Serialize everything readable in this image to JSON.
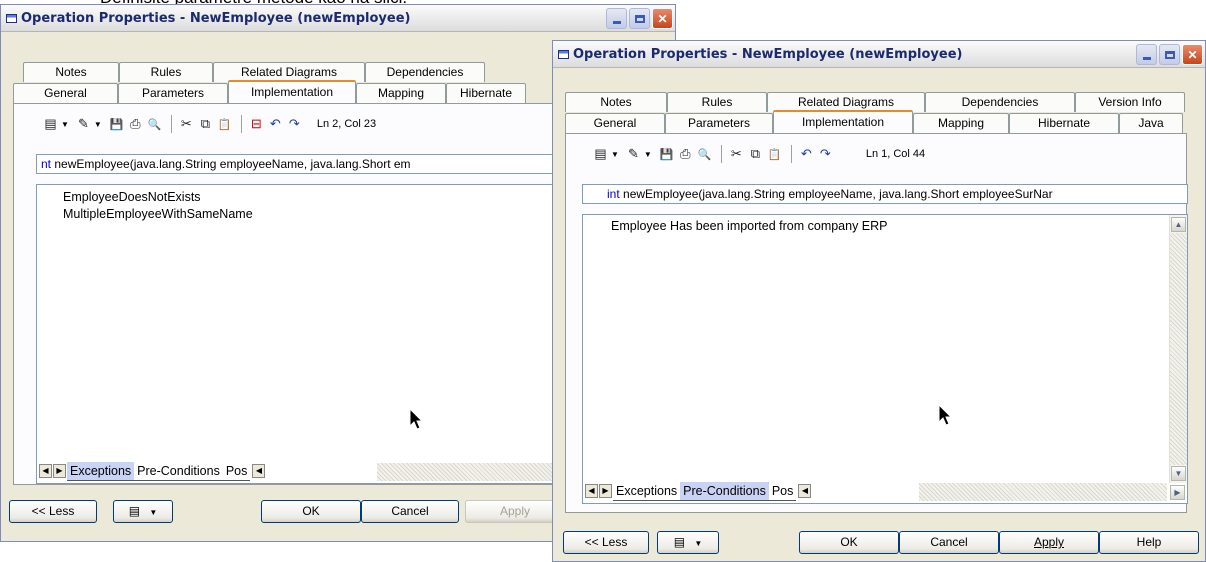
{
  "caption": "Definišite parametre metode kao na slici.",
  "window_left": {
    "title": "Operation Properties - NewEmployee (newEmployee)",
    "tabs_row1": [
      "Notes",
      "Rules",
      "Related Diagrams",
      "Dependencies"
    ],
    "tabs_row2": [
      "General",
      "Parameters",
      "Implementation",
      "Mapping",
      "Hibernate"
    ],
    "active_tab": "Implementation",
    "cursor_pos": "Ln 2, Col 23",
    "signature_kw": "nt",
    "signature_rest": " newEmployee(java.lang.String employeeName, java.lang.Short em",
    "lines": [
      "EmployeeDoesNotExists",
      "MultipleEmployeeWithSameName"
    ],
    "subtabs": [
      "Exceptions",
      "Pre-Conditions",
      "Pos"
    ],
    "selected_subtab": "Exceptions",
    "buttons": {
      "less": "<< Less",
      "ok": "OK",
      "cancel": "Cancel",
      "apply": "Apply"
    }
  },
  "window_right": {
    "title": "Operation Properties - NewEmployee (newEmployee)",
    "tabs_row1": [
      "Notes",
      "Rules",
      "Related Diagrams",
      "Dependencies",
      "Version Info"
    ],
    "tabs_row2": [
      "General",
      "Parameters",
      "Implementation",
      "Mapping",
      "Hibernate",
      "Java"
    ],
    "active_tab": "Implementation",
    "cursor_pos": "Ln 1, Col 44",
    "signature_kw": "int",
    "signature_rest": " newEmployee(java.lang.String employeeName, java.lang.Short employeeSurNar",
    "lines": [
      "Employee Has been imported from company ERP"
    ],
    "subtabs": [
      "Exceptions",
      "Pre-Conditions",
      "Pos"
    ],
    "selected_subtab": "Pre-Conditions",
    "buttons": {
      "less": "<< Less",
      "ok": "OK",
      "cancel": "Cancel",
      "apply": "Apply",
      "help": "Help"
    }
  },
  "icons": {
    "properties": "▤",
    "edit": "✎",
    "save": "💾",
    "print": "⎙",
    "find": "🔍",
    "cut": "✂",
    "copy": "⧉",
    "paste": "📋",
    "undo": "↶",
    "redo": "↷",
    "insert": "⊟",
    "dropdown": "▼",
    "left": "◀",
    "right": "▶",
    "up": "▲",
    "down": "▼",
    "minimize": "_",
    "close": "✕"
  }
}
